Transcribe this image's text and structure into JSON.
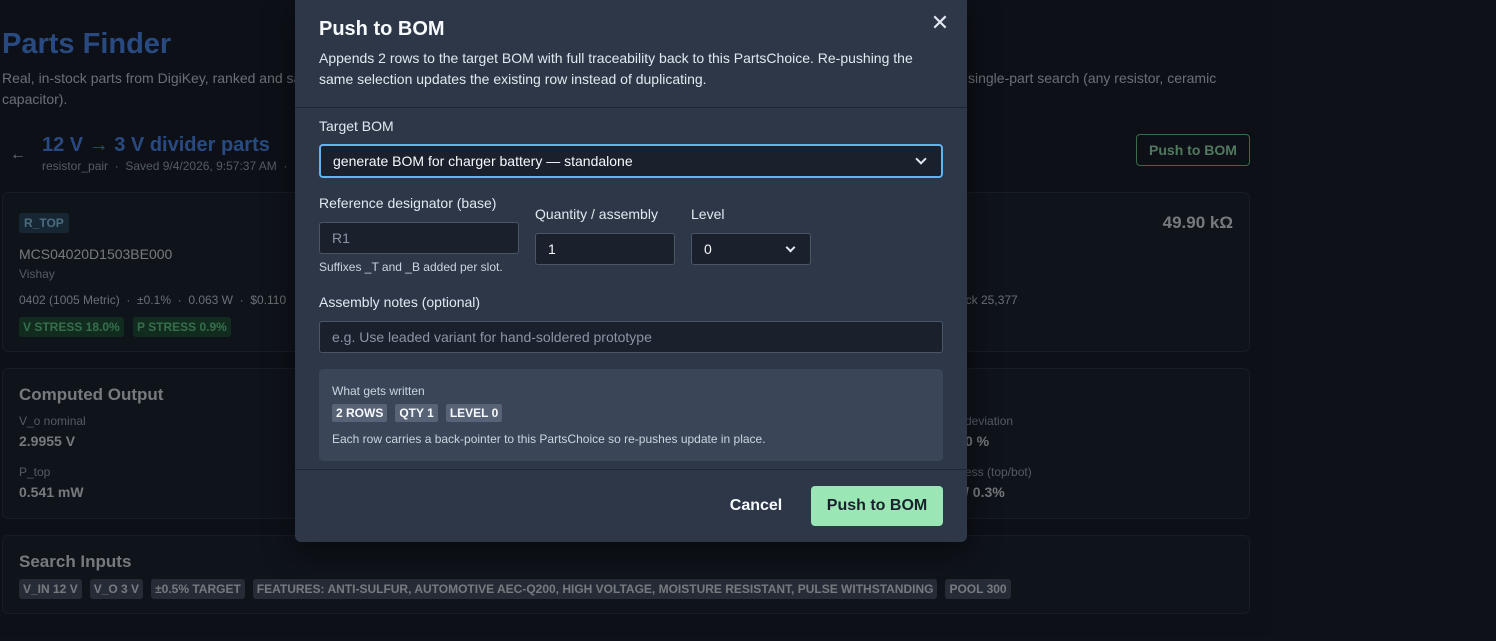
{
  "page": {
    "title": "Parts Finder",
    "description_left": "Real, in-stock parts from DigiKey, ranked and sa",
    "description_right": "single-part search (any resistor, ceramic",
    "description_line2": "capacitor).",
    "back_icon": "arrow-left-icon",
    "selection_title": "12 V → 3 V divider parts",
    "selection_meta": "resistor_pair  ·  Saved 9/4/2026, 9:57:37 AM  ·",
    "push_button": "Push to BOM"
  },
  "part_card": {
    "slot": "R_TOP",
    "mpn": "MCS04020D1503BE000",
    "manufacturer": "Vishay",
    "specs": "0402 (1005 Metric)  ·  ±0.1%  ·  0.063 W  ·  $0.110",
    "stock": "ock 25,377",
    "value": "49.90 kΩ",
    "v_stress": "V STRESS 18.0%",
    "p_stress": "P STRESS 0.9%"
  },
  "computed_output": {
    "title": "Computed Output",
    "vo_label": "V_o nominal",
    "vo_value": "2.9955 V",
    "ptop_label": "P_top",
    "ptop_value": "0.541 mW",
    "deviation_label": "deviation",
    "deviation_value": "0 %",
    "stress_label": "ess (top/bot)",
    "stress_value": "/ 0.3%"
  },
  "search_inputs": {
    "title": "Search Inputs",
    "chips": [
      "V_IN 12 V",
      "V_O 3 V",
      "±0.5% TARGET",
      "FEATURES: ANTI-SULFUR, AUTOMOTIVE AEC-Q200, HIGH VOLTAGE, MOISTURE RESISTANT, PULSE WITHSTANDING",
      "POOL 300"
    ]
  },
  "modal": {
    "title": "Push to BOM",
    "close_icon": "close-icon",
    "subtitle": "Appends 2 rows to the target BOM with full traceability back to this PartsChoice. Re-pushing the same selection updates the existing row instead of duplicating.",
    "target_bom_label": "Target BOM",
    "target_bom_value": "generate BOM for charger battery — standalone",
    "refdes_label": "Reference designator (base)",
    "refdes_placeholder": "R1",
    "refdes_hint": "Suffixes _T and _B added per slot.",
    "qty_label": "Quantity / assembly",
    "qty_value": "1",
    "level_label": "Level",
    "level_value": "0",
    "notes_label": "Assembly notes (optional)",
    "notes_placeholder": "e.g. Use leaded variant for hand-soldered prototype",
    "summary_title": "What gets written",
    "summary_chips": [
      "2 ROWS",
      "QTY 1",
      "LEVEL 0"
    ],
    "summary_note": "Each row carries a back-pointer to this PartsChoice so re-pushes update in place.",
    "cancel": "Cancel",
    "submit": "Push to BOM"
  }
}
